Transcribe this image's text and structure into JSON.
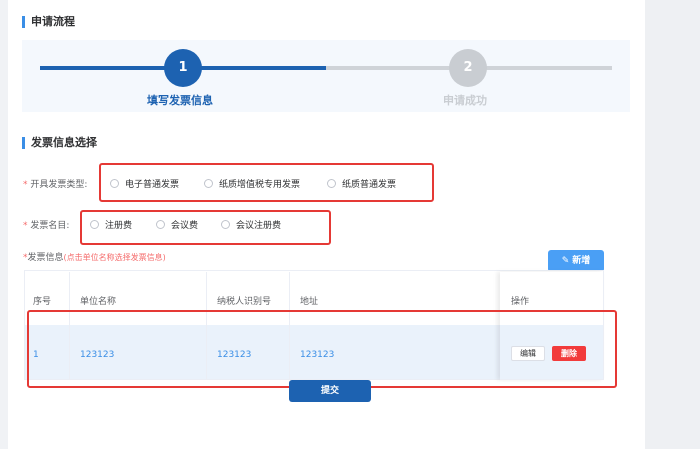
{
  "process": {
    "title": "申请流程",
    "steps": [
      {
        "number": "1",
        "label": "填写发票信息",
        "state": "active"
      },
      {
        "number": "2",
        "label": "申请成功",
        "state": "pending"
      }
    ]
  },
  "invoice_selection": {
    "title": "发票信息选择",
    "invoice_type": {
      "required_mark": "*",
      "label": "开具发票类型:",
      "options": [
        "电子普通发票",
        "纸质增值税专用发票",
        "纸质普通发票"
      ]
    },
    "invoice_name": {
      "required_mark": "*",
      "label": "发票名目:",
      "options": [
        "注册费",
        "会议费",
        "会议注册费"
      ]
    },
    "invoice_info": {
      "required_mark": "*",
      "label": "发票信息",
      "hint": "(点击单位名称选择发票信息)"
    },
    "add_button": "新增"
  },
  "table": {
    "columns": [
      "序号",
      "单位名称",
      "纳税人识别号",
      "地址",
      "操作"
    ],
    "rows": [
      {
        "index": "1",
        "company": "123123",
        "tax_id": "123123",
        "address": "123123"
      }
    ],
    "edit_label": "编辑",
    "delete_label": "删除"
  },
  "submit_label": "提交",
  "colors": {
    "primary": "#1d62b1",
    "accent": "#4a9ff5",
    "danger": "#f23b3b",
    "highlight_box": "#e53935"
  }
}
